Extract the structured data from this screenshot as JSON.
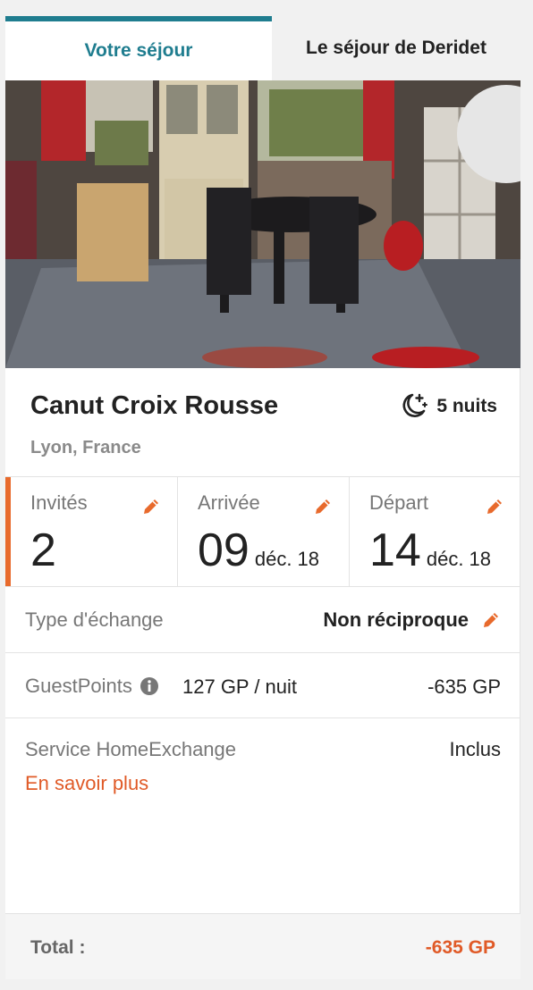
{
  "tabs": [
    {
      "label": "Votre séjour",
      "active": true
    },
    {
      "label": "Le séjour de Deridet",
      "active": false
    }
  ],
  "listing": {
    "title": "Canut Croix Rousse",
    "location": "Lyon, France",
    "nights": "5 nuits",
    "nights_icon": "moon-stars-icon",
    "photo_icon": "room-photo"
  },
  "cells": {
    "guests": {
      "label": "Invités",
      "value": "2"
    },
    "arrival": {
      "label": "Arrivée",
      "day": "09",
      "month": "déc. 18"
    },
    "departure": {
      "label": "Départ",
      "day": "14",
      "month": "déc. 18"
    }
  },
  "exchange": {
    "label": "Type d'échange",
    "value": "Non réciproque"
  },
  "guestpoints": {
    "label": "GuestPoints",
    "rate": "127 GP / nuit",
    "amount": "-635 GP"
  },
  "service": {
    "label": "Service HomeExchange",
    "value": "Inclus",
    "link": "En savoir plus"
  },
  "total": {
    "label": "Total :",
    "value": "-635 GP"
  },
  "colors": {
    "accent": "#1f7d8f",
    "orange": "#e86a2c",
    "link": "#e05a27"
  }
}
